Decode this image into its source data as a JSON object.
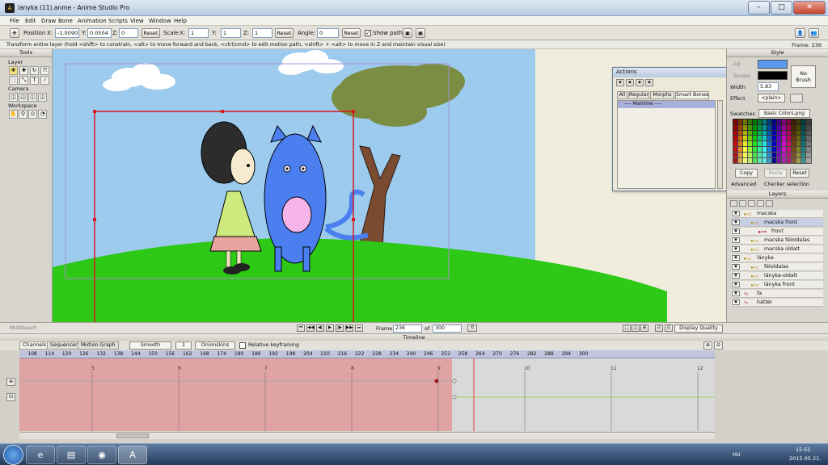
{
  "window": {
    "title": "lanyka (11).anme - Anime Studio Pro",
    "min": "–",
    "max": "□",
    "close": "✕"
  },
  "menu": [
    "File",
    "Edit",
    "Draw",
    "Bone",
    "Animation",
    "Scripts",
    "View",
    "Window",
    "Help"
  ],
  "toolbar": {
    "position_label": "Position",
    "x_label": "X:",
    "x_value": "-1.0090",
    "y_label": "Y:",
    "y_value": "0.0504",
    "z_label": "Z:",
    "z_value": "0",
    "reset_label": "Reset",
    "scale_label": "Scale",
    "sx_label": "X:",
    "sx_value": "1",
    "sy_label": "Y:",
    "sy_value": "1",
    "sz_label": "Z:",
    "sz_value": "1",
    "angle_label": "Angle:",
    "angle_value": "0",
    "show_path_label": "Show path"
  },
  "status": {
    "hint": "Transform entire layer (hold <shift> to constrain, <alt> to move forward and back, <ctrl/cmd> to edit motion path, <shift> + <alt> to move in Z and maintain visual size)",
    "frame": "Frame: 236"
  },
  "tools": {
    "title": "Tools",
    "layer": "Layer",
    "camera": "Camera",
    "workspace": "Workspace",
    "layer_icons": [
      "✥",
      "✚",
      "↻",
      "⤧",
      "⬚",
      "⤡",
      "T",
      "⁄"
    ],
    "camera_icons": [
      "◫",
      "◫",
      "◫",
      "◫",
      "◫"
    ],
    "workspace_icons": [
      "✋",
      "⚲",
      "⊙",
      "◔"
    ]
  },
  "actions": {
    "title": "Actions",
    "tabs": [
      "All",
      "Regular",
      "Morphs",
      "Smart Bones"
    ],
    "items": [
      "---- Mainline ----"
    ]
  },
  "style": {
    "title": "Style",
    "fill_label": "Fill",
    "stroke_label": "Stroke",
    "width_label": "Width",
    "width_value": "5.83",
    "no_brush": "No Brush",
    "effect_label": "Effect",
    "effect_value": "<plain>",
    "swatches_label": "Swatches",
    "swatches_value": "Basic Colors.png",
    "copy": "Copy",
    "paste": "Paste",
    "reset": "Reset",
    "advanced": "Advanced",
    "checker": "Checker selection",
    "fill_color": "#5b9bef",
    "stroke_color": "#000000"
  },
  "layers": {
    "title": "Layers",
    "items": [
      {
        "name": "macska",
        "indent": 0,
        "type": "group"
      },
      {
        "name": "macska front",
        "indent": 1,
        "type": "group"
      },
      {
        "name": "front",
        "indent": 2,
        "type": "bone"
      },
      {
        "name": "macska féloldalas",
        "indent": 1,
        "type": "group"
      },
      {
        "name": "macska oldalt",
        "indent": 1,
        "type": "group"
      },
      {
        "name": "lányka",
        "indent": 0,
        "type": "group"
      },
      {
        "name": "féloldalas",
        "indent": 1,
        "type": "group"
      },
      {
        "name": "lányka-oldalt",
        "indent": 1,
        "type": "group"
      },
      {
        "name": "lányka front",
        "indent": 1,
        "type": "group"
      },
      {
        "name": "fa",
        "indent": 0,
        "type": "vector"
      },
      {
        "name": "háttér",
        "indent": 0,
        "type": "vector"
      }
    ]
  },
  "playback": {
    "multitouch": "Multitouch",
    "frame_label": "Frame",
    "frame_value": "236",
    "of_label": "of",
    "total_frames": "300",
    "display_quality": "Display Quality"
  },
  "timeline": {
    "title": "Timeline",
    "tabs": [
      "Channels",
      "Sequencer",
      "Motion Graph"
    ],
    "interp": "Smooth",
    "interp_num": "1",
    "onionskins": "Onionskins",
    "relative": "Relative keyframing",
    "ruler": [
      "108",
      "114",
      "120",
      "126",
      "132",
      "138",
      "144",
      "150",
      "156",
      "162",
      "168",
      "174",
      "180",
      "186",
      "192",
      "198",
      "204",
      "210",
      "216",
      "222",
      "228",
      "234",
      "240",
      "246",
      "252",
      "258",
      "264",
      "270",
      "276",
      "282",
      "288",
      "294",
      "300"
    ],
    "second_markers": [
      "5",
      "6",
      "7",
      "8",
      "9",
      "10",
      "11",
      "12"
    ]
  },
  "taskbar": {
    "clock_time": "15:51",
    "clock_date": "2015.05.21.",
    "lang": "HU",
    "apps": [
      "ie-icon",
      "folder-icon",
      "chrome-icon",
      "anime-studio-icon"
    ]
  }
}
